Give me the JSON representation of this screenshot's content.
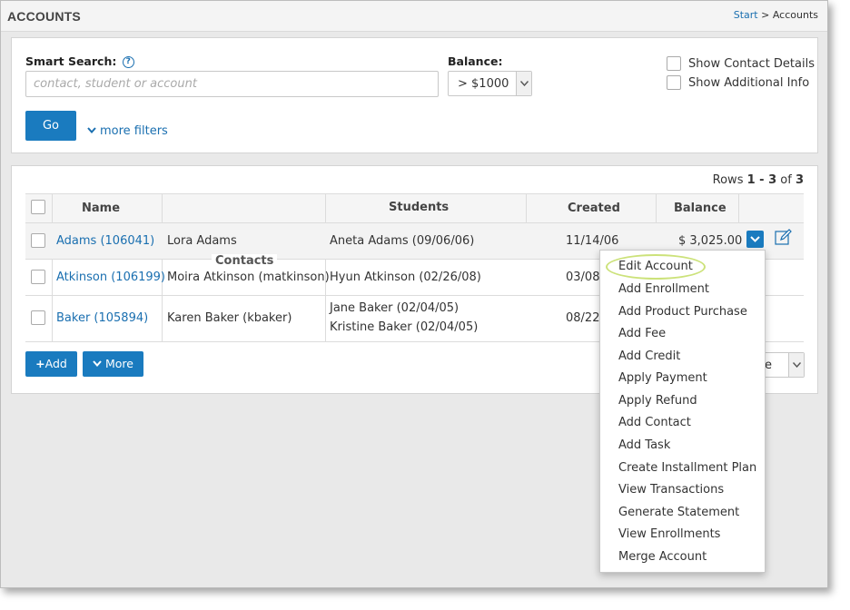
{
  "header": {
    "title": "ACCOUNTS",
    "breadcrumb_start": "Start",
    "breadcrumb_sep": ">",
    "breadcrumb_current": "Accounts"
  },
  "search": {
    "smart_search_label": "Smart Search:",
    "help_glyph": "?",
    "placeholder": "contact, student or account",
    "balance_label": "Balance:",
    "balance_value": "> $1000",
    "show_contact_details": "Show Contact Details",
    "show_additional_info": "Show Additional Info",
    "go_label": "Go",
    "more_filters": "more filters"
  },
  "results": {
    "rows_prefix": "Rows ",
    "rows_from": "1",
    "rows_dash": " - ",
    "rows_to": "3",
    "rows_of": " of ",
    "rows_total": "3",
    "headers": {
      "name": "Name",
      "students": "Students",
      "created": "Created",
      "balance": "Balance"
    },
    "contacts_label": "Contacts",
    "rows": [
      {
        "name": "Adams (106041)",
        "contact": "Lora Adams",
        "students": [
          "Aneta Adams (09/06/06)"
        ],
        "created": "11/14/06",
        "balance": "$ 3,025.00"
      },
      {
        "name": "Atkinson (106199)",
        "contact": "Moira Atkinson (matkinson)",
        "students": [
          "Hyun Atkinson (02/26/08)"
        ],
        "created": "03/08/",
        "balance": ""
      },
      {
        "name": "Baker (105894)",
        "contact": "Karen Baker (kbaker)",
        "students": [
          "Jane Baker (02/04/05)",
          "Kristine Baker (02/04/05)"
        ],
        "created": "08/22/",
        "balance": ""
      }
    ],
    "add_label": "Add",
    "add_glyph": "+",
    "more_label": "More",
    "bottom_select_value": "e"
  },
  "menu": {
    "items": [
      "Edit Account",
      "Add Enrollment",
      "Add Product Purchase",
      "Add Fee",
      "Add Credit",
      "Apply Payment",
      "Apply Refund",
      "Add Contact",
      "Add Task",
      "Create Installment Plan",
      "View Transactions",
      "Generate Statement",
      "View Enrollments",
      "Merge Account"
    ]
  },
  "colors": {
    "accent": "#1a7bbf",
    "link": "#1a6fb0",
    "highlight": "#cce27a"
  }
}
